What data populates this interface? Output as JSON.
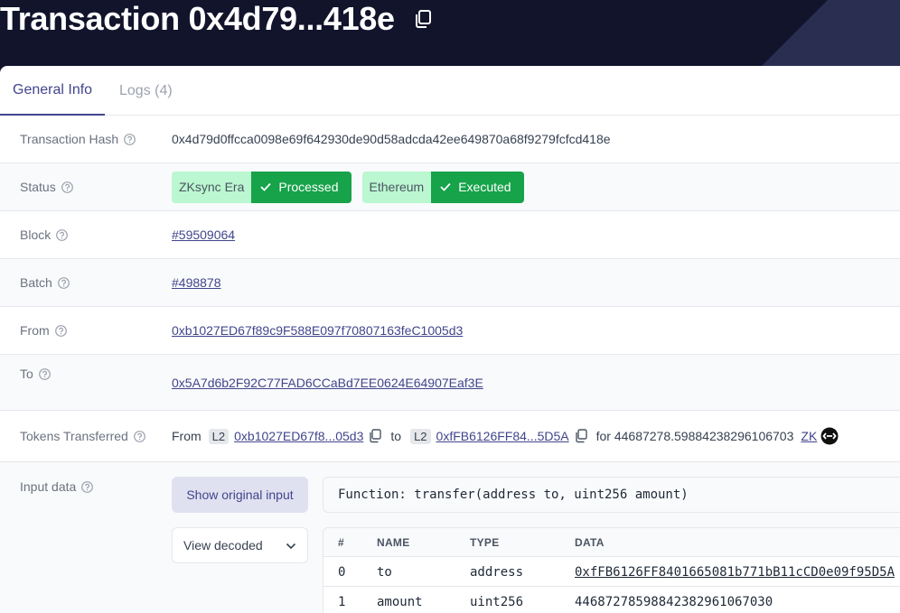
{
  "header": {
    "title": "Transaction 0x4d79...418e",
    "copy_icon": "copy-icon"
  },
  "tabs": [
    {
      "label": "General Info",
      "active": true
    },
    {
      "label": "Logs (4)",
      "active": false
    }
  ],
  "details": {
    "hash": {
      "label": "Transaction Hash",
      "value": "0x4d79d0ffcca0098e69f642930de90d58adcda42ee649870a68f9279fcfcd418e"
    },
    "status": {
      "label": "Status",
      "l2": {
        "network": "ZKsync Era",
        "state": "Processed"
      },
      "l1": {
        "network": "Ethereum",
        "state": "Executed"
      }
    },
    "block": {
      "label": "Block",
      "value": "#59509064"
    },
    "batch": {
      "label": "Batch",
      "value": "#498878"
    },
    "from": {
      "label": "From",
      "value": "0xb1027ED67f89c9F588E097f70807163feC1005d3"
    },
    "to": {
      "label": "To",
      "value": "0x5A7d6b2F92C77FAD6CCaBd7EE0624E64907Eaf3E"
    },
    "tokens": {
      "label": "Tokens Transferred",
      "from_word": "From",
      "from_badge": "L2",
      "from_addr": "0xb1027ED67f8...05d3",
      "to_word": "to",
      "to_badge": "L2",
      "to_addr": "0xfFB6126FF84...5D5A",
      "for_text": "for 44687278.59884238296106703",
      "token_symbol": "ZK"
    },
    "input": {
      "label": "Input data",
      "show_original_label": "Show original input",
      "function_signature": "Function: transfer(address to, uint256 amount)",
      "view_select": "View decoded",
      "columns": [
        "#",
        "NAME",
        "TYPE",
        "DATA"
      ],
      "rows": [
        {
          "index": "0",
          "name": "to",
          "type": "address",
          "data": "0xfFB6126FF8401665081b771bB11cCD0e09f95D5A"
        },
        {
          "index": "1",
          "name": "amount",
          "type": "uint256",
          "data": "44687278598842382961067030"
        }
      ]
    }
  },
  "colors": {
    "hero_bg": "#11142b",
    "accent": "#42458c",
    "success": "#16a34a",
    "success_light": "#bbf7d0"
  }
}
